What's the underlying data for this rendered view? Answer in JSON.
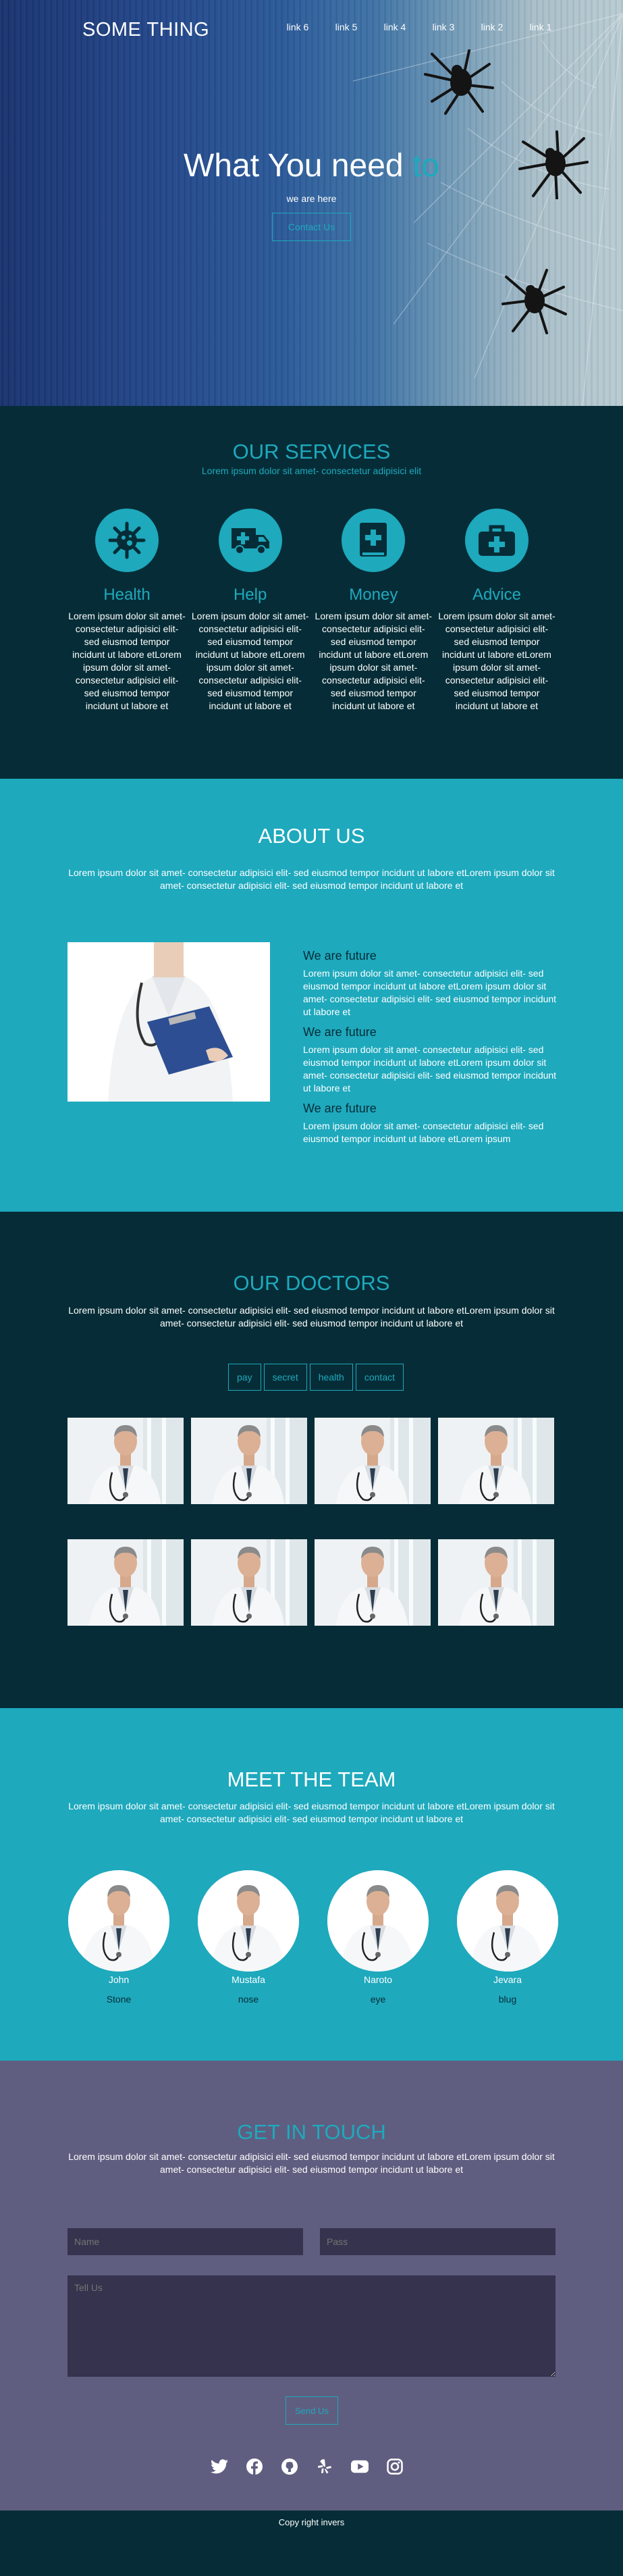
{
  "header": {
    "brand": "SOME THING",
    "nav": [
      "link 6",
      "link 5",
      "link 4",
      "link 3",
      "link 2",
      "link 1"
    ]
  },
  "hero": {
    "title_main": "What You need",
    "title_accent": "to",
    "subtitle": "we are here",
    "cta_label": "Contact Us"
  },
  "services": {
    "title": "OUR SERVICES",
    "lead": "Lorem ipsum dolor sit amet- consectetur adipisici elit",
    "items": [
      {
        "icon": "virus-icon",
        "title": "Health",
        "text": "Lorem ipsum dolor sit amet- consectetur adipisici elit- sed eiusmod tempor incidunt ut labore etLorem ipsum dolor sit amet- consectetur adipisici elit- sed eiusmod tempor incidunt ut labore et"
      },
      {
        "icon": "ambulance-icon",
        "title": "Help",
        "text": "Lorem ipsum dolor sit amet- consectetur adipisici elit- sed eiusmod tempor incidunt ut labore etLorem ipsum dolor sit amet- consectetur adipisici elit- sed eiusmod tempor incidunt ut labore et"
      },
      {
        "icon": "medical-book-icon",
        "title": "Money",
        "text": "Lorem ipsum dolor sit amet- consectetur adipisici elit- sed eiusmod tempor incidunt ut labore etLorem ipsum dolor sit amet- consectetur adipisici elit- sed eiusmod tempor incidunt ut labore et"
      },
      {
        "icon": "first-aid-kit-icon",
        "title": "Advice",
        "text": "Lorem ipsum dolor sit amet- consectetur adipisici elit- sed eiusmod tempor incidunt ut labore etLorem ipsum dolor sit amet- consectetur adipisici elit- sed eiusmod tempor incidunt ut labore et"
      }
    ]
  },
  "about": {
    "title": "ABOUT US",
    "lead": "Lorem ipsum dolor sit amet- consectetur adipisici elit- sed eiusmod tempor incidunt ut labore etLorem ipsum dolor sit amet- consectetur adipisici elit- sed eiusmod tempor incidunt ut labore et",
    "blocks": [
      {
        "heading": "We are future",
        "text": "Lorem ipsum dolor sit amet- consectetur adipisici elit- sed eiusmod tempor incidunt ut labore etLorem ipsum dolor sit amet- consectetur adipisici elit- sed eiusmod tempor incidunt ut labore et"
      },
      {
        "heading": "We are future",
        "text": "Lorem ipsum dolor sit amet- consectetur adipisici elit- sed eiusmod tempor incidunt ut labore etLorem ipsum dolor sit amet- consectetur adipisici elit- sed eiusmod tempor incidunt ut labore et"
      },
      {
        "heading": "We are future",
        "text": "Lorem ipsum dolor sit amet- consectetur adipisici elit- sed eiusmod tempor incidunt ut labore etLorem ipsum"
      }
    ]
  },
  "doctors": {
    "title": "OUR DOCTORS",
    "lead": "Lorem ipsum dolor sit amet- consectetur adipisici elit- sed eiusmod tempor incidunt ut labore etLorem ipsum dolor sit amet- consectetur adipisici elit- sed eiusmod tempor incidunt ut labore et",
    "filters": [
      "pay",
      "secret",
      "health",
      "contact"
    ]
  },
  "team": {
    "title": "MEET THE TEAM",
    "lead": "Lorem ipsum dolor sit amet- consectetur adipisici elit- sed eiusmod tempor incidunt ut labore etLorem ipsum dolor sit amet- consectetur adipisici elit- sed eiusmod tempor incidunt ut labore et",
    "members": [
      {
        "name": "John",
        "role": "Stone"
      },
      {
        "name": "Mustafa",
        "role": "nose"
      },
      {
        "name": "Naroto",
        "role": "eye"
      },
      {
        "name": "Jevara",
        "role": "blug"
      }
    ]
  },
  "contact": {
    "title": "GET IN TOUCH",
    "lead": "Lorem ipsum dolor sit amet- consectetur adipisici elit- sed eiusmod tempor incidunt ut labore etLorem ipsum dolor sit amet- consectetur adipisici elit- sed eiusmod tempor incidunt ut labore et",
    "name_placeholder": "Name",
    "pass_placeholder": "Pass",
    "message_placeholder": "Tell Us",
    "send_label": "Send Us",
    "social": [
      "twitter-icon",
      "facebook-icon",
      "github-icon",
      "yelp-icon",
      "youtube-icon",
      "instagram-icon"
    ]
  },
  "footer": {
    "copyright": "Copy right invers"
  },
  "colors": {
    "accent": "#1ea9bd",
    "dark": "#062d37",
    "contact_bg": "#5f5e80",
    "input_bg": "#35334d"
  }
}
